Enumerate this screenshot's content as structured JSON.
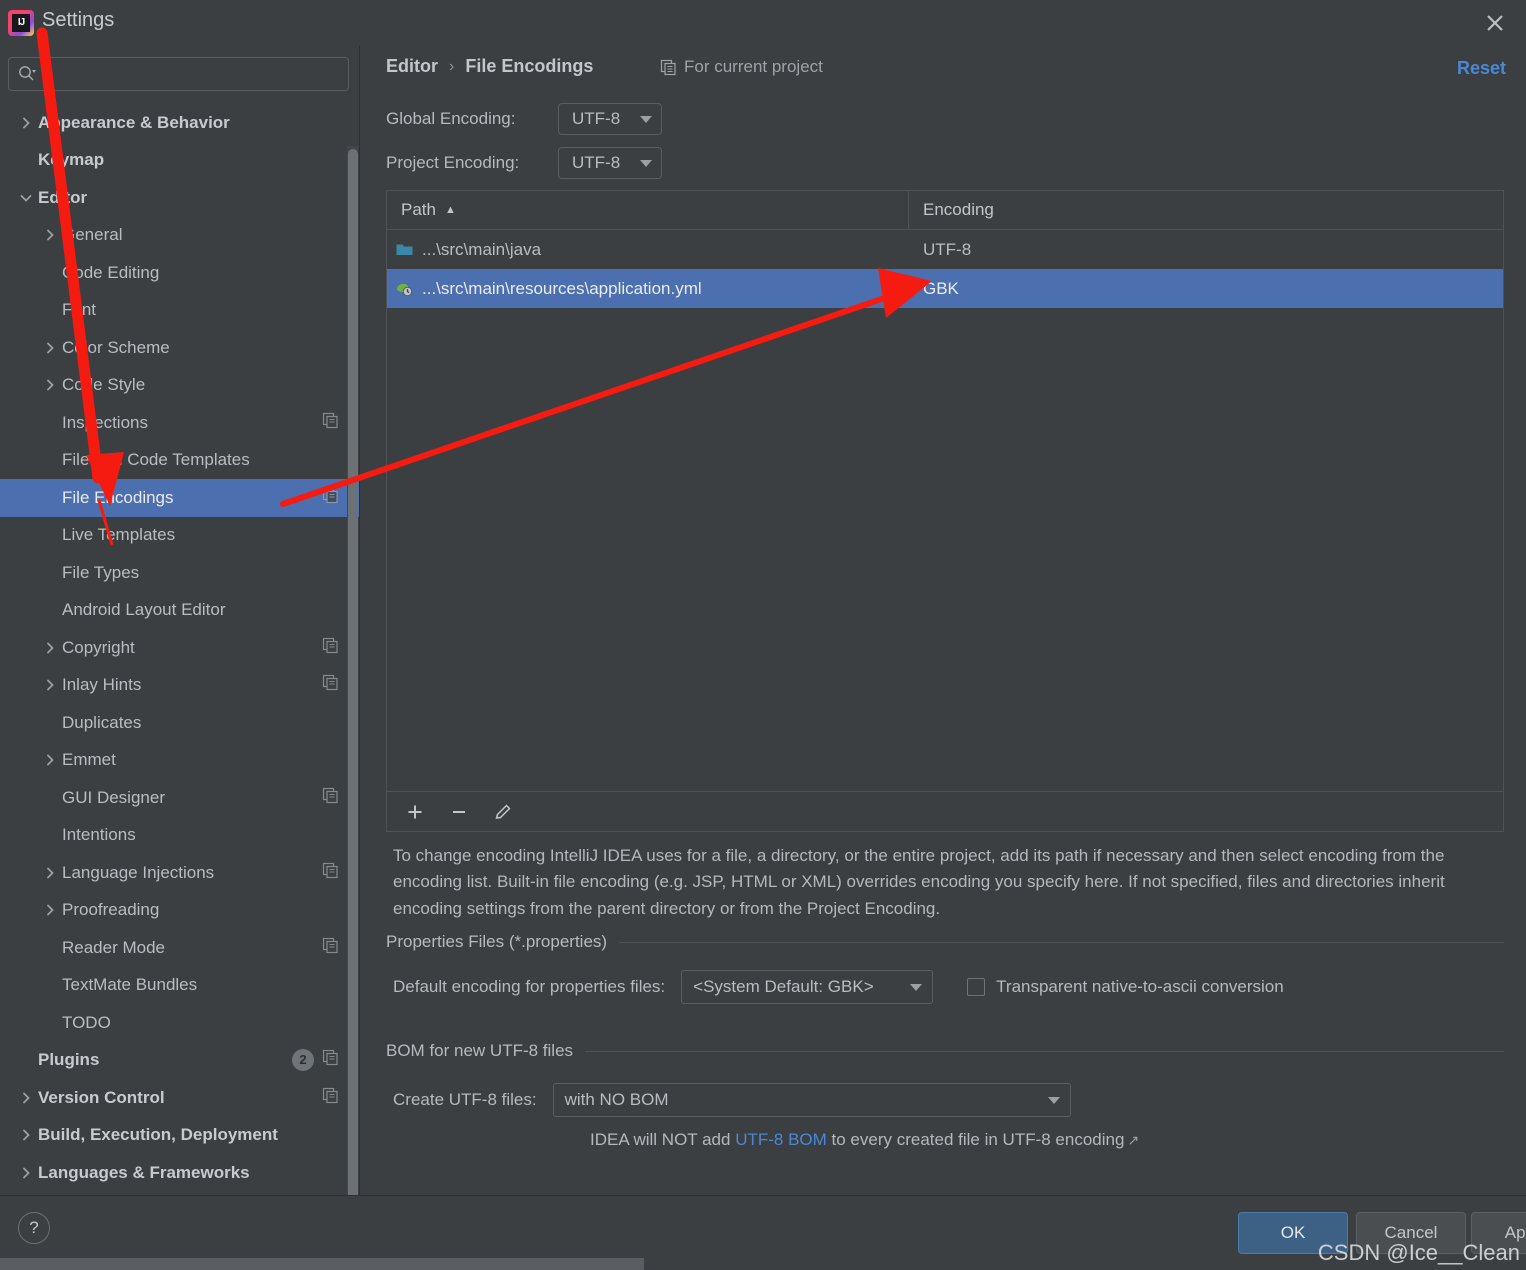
{
  "window": {
    "title": "Settings",
    "logo_text": "IJ",
    "close_icon": "close-icon"
  },
  "sidebar": {
    "search": {
      "value": "",
      "placeholder": "",
      "icon": "search-icon"
    },
    "items": [
      {
        "label": "Appearance & Behavior",
        "indent": 0,
        "twisty": "chevron-right",
        "bold": true,
        "copy": false,
        "selected": false
      },
      {
        "label": "Keymap",
        "indent": 0,
        "twisty": "none",
        "bold": true,
        "copy": false,
        "selected": false
      },
      {
        "label": "Editor",
        "indent": 0,
        "twisty": "chevron-down",
        "bold": true,
        "copy": false,
        "selected": false
      },
      {
        "label": "General",
        "indent": 1,
        "twisty": "chevron-right",
        "bold": false,
        "copy": false,
        "selected": false
      },
      {
        "label": "Code Editing",
        "indent": 1,
        "twisty": "none",
        "bold": false,
        "copy": false,
        "selected": false
      },
      {
        "label": "Font",
        "indent": 1,
        "twisty": "none",
        "bold": false,
        "copy": false,
        "selected": false
      },
      {
        "label": "Color Scheme",
        "indent": 1,
        "twisty": "chevron-right",
        "bold": false,
        "copy": false,
        "selected": false
      },
      {
        "label": "Code Style",
        "indent": 1,
        "twisty": "chevron-right",
        "bold": false,
        "copy": false,
        "selected": false
      },
      {
        "label": "Inspections",
        "indent": 1,
        "twisty": "none",
        "bold": false,
        "copy": true,
        "selected": false
      },
      {
        "label": "File and Code Templates",
        "indent": 1,
        "twisty": "none",
        "bold": false,
        "copy": false,
        "selected": false
      },
      {
        "label": "File Encodings",
        "indent": 1,
        "twisty": "none",
        "bold": false,
        "copy": true,
        "selected": true
      },
      {
        "label": "Live Templates",
        "indent": 1,
        "twisty": "none",
        "bold": false,
        "copy": false,
        "selected": false
      },
      {
        "label": "File Types",
        "indent": 1,
        "twisty": "none",
        "bold": false,
        "copy": false,
        "selected": false
      },
      {
        "label": "Android Layout Editor",
        "indent": 1,
        "twisty": "none",
        "bold": false,
        "copy": false,
        "selected": false
      },
      {
        "label": "Copyright",
        "indent": 1,
        "twisty": "chevron-right",
        "bold": false,
        "copy": true,
        "selected": false
      },
      {
        "label": "Inlay Hints",
        "indent": 1,
        "twisty": "chevron-right",
        "bold": false,
        "copy": true,
        "selected": false
      },
      {
        "label": "Duplicates",
        "indent": 1,
        "twisty": "none",
        "bold": false,
        "copy": false,
        "selected": false
      },
      {
        "label": "Emmet",
        "indent": 1,
        "twisty": "chevron-right",
        "bold": false,
        "copy": false,
        "selected": false
      },
      {
        "label": "GUI Designer",
        "indent": 1,
        "twisty": "none",
        "bold": false,
        "copy": true,
        "selected": false
      },
      {
        "label": "Intentions",
        "indent": 1,
        "twisty": "none",
        "bold": false,
        "copy": false,
        "selected": false
      },
      {
        "label": "Language Injections",
        "indent": 1,
        "twisty": "chevron-right",
        "bold": false,
        "copy": true,
        "selected": false
      },
      {
        "label": "Proofreading",
        "indent": 1,
        "twisty": "chevron-right",
        "bold": false,
        "copy": false,
        "selected": false
      },
      {
        "label": "Reader Mode",
        "indent": 1,
        "twisty": "none",
        "bold": false,
        "copy": true,
        "selected": false
      },
      {
        "label": "TextMate Bundles",
        "indent": 1,
        "twisty": "none",
        "bold": false,
        "copy": false,
        "selected": false
      },
      {
        "label": "TODO",
        "indent": 1,
        "twisty": "none",
        "bold": false,
        "copy": false,
        "selected": false
      },
      {
        "label": "Plugins",
        "indent": 0,
        "twisty": "none",
        "bold": true,
        "copy": true,
        "selected": false,
        "badge": "2"
      },
      {
        "label": "Version Control",
        "indent": 0,
        "twisty": "chevron-right",
        "bold": true,
        "copy": true,
        "selected": false
      },
      {
        "label": "Build, Execution, Deployment",
        "indent": 0,
        "twisty": "chevron-right",
        "bold": true,
        "copy": false,
        "selected": false
      },
      {
        "label": "Languages & Frameworks",
        "indent": 0,
        "twisty": "chevron-right",
        "bold": true,
        "copy": false,
        "selected": false
      }
    ]
  },
  "header": {
    "breadcrumb": {
      "parent": "Editor",
      "separator": "›",
      "current": "File Encodings"
    },
    "scope_note": "For current project",
    "scope_icon": "copy-scope-icon",
    "reset_label": "Reset"
  },
  "encodings": {
    "global_label": "Global Encoding:",
    "global_value": "UTF-8",
    "project_label": "Project Encoding:",
    "project_value": "UTF-8"
  },
  "table": {
    "columns": [
      "Path",
      "Encoding"
    ],
    "sort_column": "Path",
    "sort_direction": "▲",
    "rows": [
      {
        "icon": "folder-icon",
        "path": "...\\src\\main\\java",
        "encoding": "UTF-8",
        "selected": false
      },
      {
        "icon": "spring-yml-icon",
        "path": "...\\src\\main\\resources\\application.yml",
        "encoding": "GBK",
        "selected": true
      }
    ],
    "toolbar": [
      {
        "name": "add-button",
        "glyph": "+"
      },
      {
        "name": "remove-button",
        "glyph": "−"
      },
      {
        "name": "edit-button",
        "glyph": "✎"
      }
    ]
  },
  "description": "To change encoding IntelliJ IDEA uses for a file, a directory, or the entire project, add its path if necessary and then select encoding from the encoding list. Built-in file encoding (e.g. JSP, HTML or XML) overrides encoding you specify here. If not specified, files and directories inherit encoding settings from the parent directory or from the Project Encoding.",
  "properties_section": {
    "title": "Properties Files (*.properties)",
    "default_encoding_label": "Default encoding for properties files:",
    "default_encoding_value": "<System Default: GBK>",
    "transparent_checkbox_label": "Transparent native-to-ascii conversion",
    "transparent_checked": false
  },
  "bom_section": {
    "title": "BOM for new UTF-8 files",
    "create_label": "Create UTF-8 files:",
    "create_value": "with NO BOM",
    "note_prefix": "IDEA will NOT add ",
    "note_link": "UTF-8 BOM",
    "note_suffix": " to every created file in UTF-8 encoding",
    "external_link_icon": "↗"
  },
  "footer": {
    "help_glyph": "?",
    "ok_label": "OK",
    "cancel_label": "Cancel",
    "apply_label": "Apply"
  },
  "watermark": "CSDN @Ice__Clean",
  "colors": {
    "background": "#3C3F41",
    "selection_blue": "#4C6FAF",
    "link_blue": "#4A88D4",
    "annotation_red": "#F51B11",
    "folder_icon": "#3A87A8",
    "spring_icon": "#6DB33F"
  }
}
